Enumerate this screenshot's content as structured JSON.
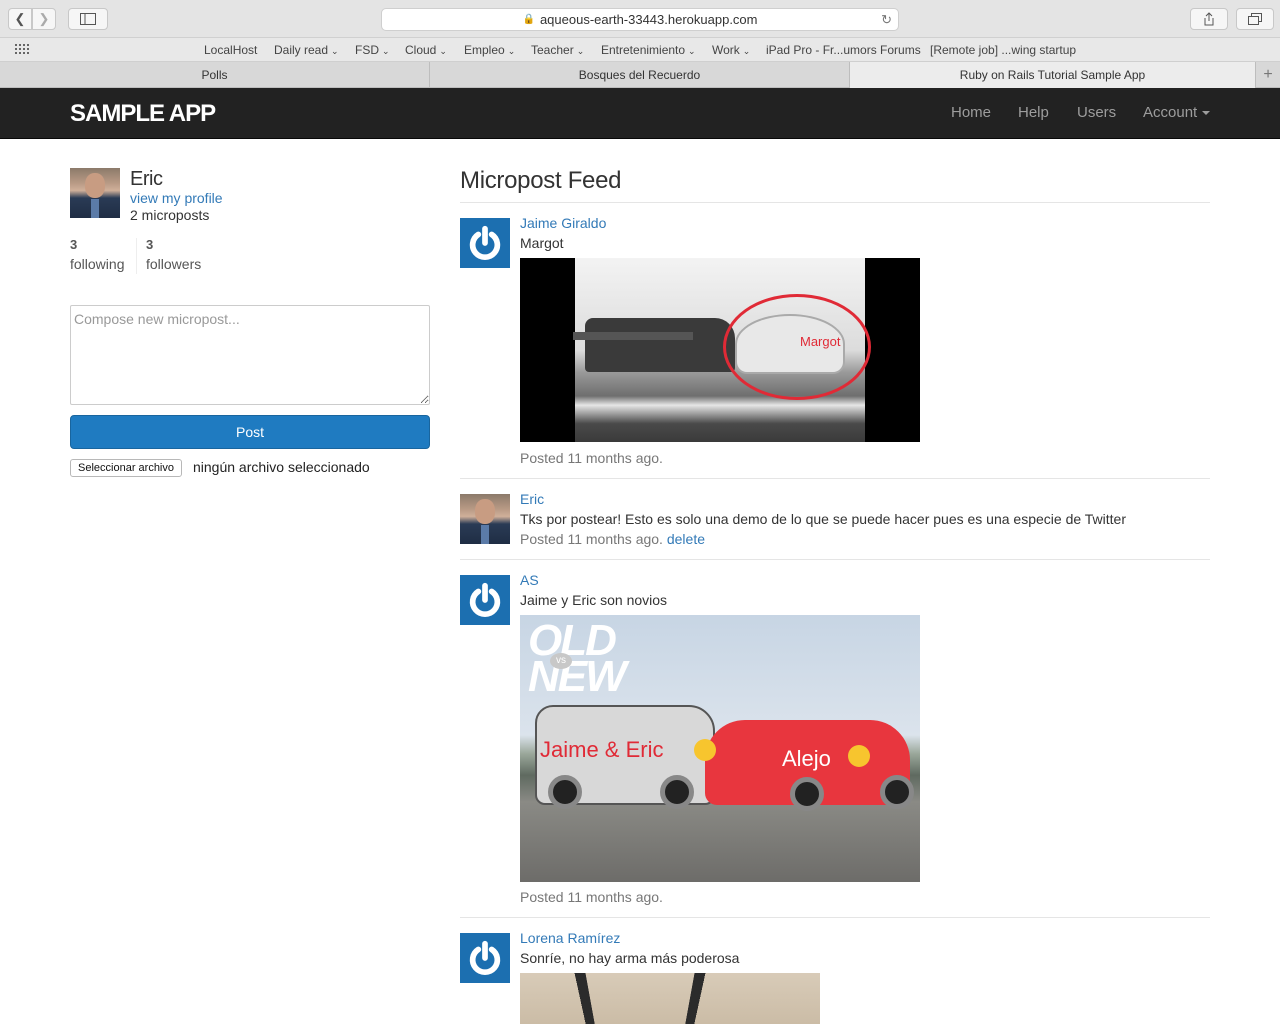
{
  "browser": {
    "url": "aqueous-earth-33443.herokuapp.com",
    "favorites": [
      {
        "label": "LocalHost",
        "dropdown": false
      },
      {
        "label": "Daily read",
        "dropdown": true
      },
      {
        "label": "FSD",
        "dropdown": true
      },
      {
        "label": "Cloud",
        "dropdown": true
      },
      {
        "label": "Empleo",
        "dropdown": true
      },
      {
        "label": "Teacher",
        "dropdown": true
      },
      {
        "label": "Entretenimiento",
        "dropdown": true
      },
      {
        "label": "Work",
        "dropdown": true
      },
      {
        "label": "iPad Pro - Fr...umors Forums",
        "dropdown": false
      },
      {
        "label": "[Remote job] ...wing startup",
        "dropdown": false
      }
    ],
    "tabs": [
      {
        "label": "Polls",
        "active": false
      },
      {
        "label": "Bosques del Recuerdo",
        "active": false
      },
      {
        "label": "Ruby on Rails Tutorial Sample App",
        "active": true
      }
    ]
  },
  "header": {
    "logo": "SAMPLE APP",
    "nav": {
      "home": "Home",
      "help": "Help",
      "users": "Users",
      "account": "Account"
    }
  },
  "sidebar": {
    "user_name": "Eric",
    "profile_link": "view my profile",
    "micropost_count": "2 microposts",
    "following_count": "3",
    "following_label": "following",
    "followers_count": "3",
    "followers_label": "followers",
    "compose_placeholder": "Compose new micropost...",
    "post_button": "Post",
    "file_button": "Seleccionar archivo",
    "file_status": "ningún archivo seleccionado"
  },
  "feed": {
    "title": "Micropost Feed",
    "posts": [
      {
        "user": "Jaime Giraldo",
        "content": "Margot",
        "image_caption": "Margot",
        "time": "Posted 11 months ago."
      },
      {
        "user": "Eric",
        "content": "Tks por postear! Esto es solo una demo de lo que se puede hacer pues es una especie de Twitter",
        "time": "Posted 11 months ago.",
        "delete": "delete"
      },
      {
        "user": "AS",
        "content": "Jaime y Eric son novios",
        "image_badge_top": "OLD",
        "image_badge_vs": "vs",
        "image_badge_bottom": "NEW",
        "image_label_left": "Jaime & Eric",
        "image_label_right": "Alejo",
        "time": "Posted 11 months ago."
      },
      {
        "user": "Lorena Ramírez",
        "content": "Sonríe, no hay arma más poderosa"
      }
    ]
  },
  "colors": {
    "navbar_bg": "#222222",
    "link": "#337ab7",
    "post_button": "#1f7bc1",
    "gravatar": "#1c6fb0",
    "annotation_red": "#e02a36"
  }
}
